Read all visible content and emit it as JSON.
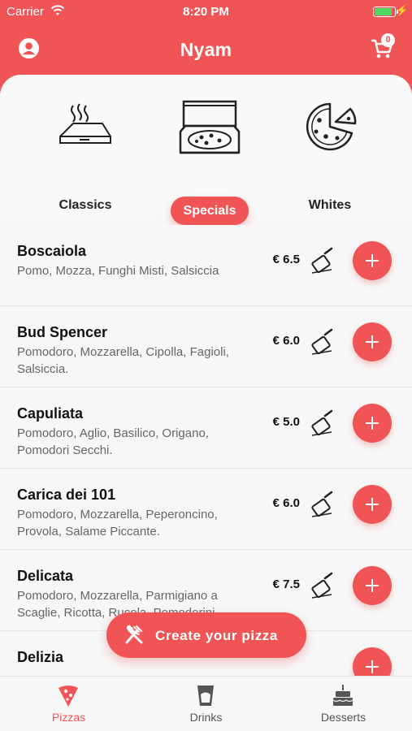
{
  "status_bar": {
    "carrier": "Carrier",
    "time": "8:20 PM"
  },
  "header": {
    "title": "Nyam",
    "cart_count": "0"
  },
  "categories": [
    {
      "label": "Classics",
      "icon": "pizza-box-closed-icon",
      "selected": false
    },
    {
      "label": "Specials",
      "icon": "pizza-box-open-icon",
      "selected": true
    },
    {
      "label": "Whites",
      "icon": "pizza-icon",
      "selected": false
    }
  ],
  "pizzas": [
    {
      "name": "Boscaiola",
      "ingredients": "Pomo, Mozza, Funghi Misti, Salsiccia",
      "price": "€ 6.5"
    },
    {
      "name": "Bud Spencer",
      "ingredients": "Pomodoro, Mozzarella, Cipolla, Fagioli, Salsiccia.",
      "price": "€ 6.0"
    },
    {
      "name": "Capuliata",
      "ingredients": "Pomodoro, Aglio, Basilico, Origano, Pomodori Secchi.",
      "price": "€ 5.0"
    },
    {
      "name": "Carica dei 101",
      "ingredients": "Pomodoro, Mozzarella, Peperoncino, Provola, Salame Piccante.",
      "price": "€ 6.0"
    },
    {
      "name": "Delicata",
      "ingredients": "Pomodoro, Mozzarella, Parmigiano a Scaglie, Ricotta, Rucola, Pomodorini.",
      "price": "€ 7.5"
    },
    {
      "name": "Delizia",
      "ingredients": "",
      "price": ""
    }
  ],
  "fab": {
    "label": "Create your pizza"
  },
  "tabs": [
    {
      "label": "Pizzas",
      "icon": "pizza-slice-icon",
      "active": true
    },
    {
      "label": "Drinks",
      "icon": "cup-icon",
      "active": false
    },
    {
      "label": "Desserts",
      "icon": "cake-icon",
      "active": false
    }
  ],
  "colors": {
    "accent": "#f05454",
    "active_tab": "#f05454",
    "battery": "#4cd964"
  }
}
